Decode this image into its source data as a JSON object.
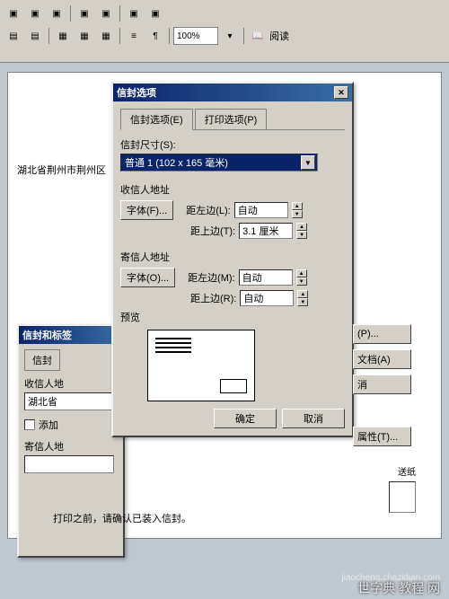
{
  "toolbar": {
    "zoom": "100%",
    "read_label": "阅读"
  },
  "doc": {
    "address": "湖北省荆州市荆州区"
  },
  "back_dialog": {
    "title": "信封和标签",
    "tab_envelope": "信封",
    "recipient_label": "收信人地",
    "input_value": "湖北省",
    "add_checkbox": "添加",
    "sender_label": "寄信人地"
  },
  "dialog": {
    "title": "信封选项",
    "tab_envelope": "信封选项(E)",
    "tab_print": "打印选项(P)",
    "size_label": "信封尺寸(S):",
    "size_value": "普通 1      (102 x 165 毫米)",
    "recipient_section": "收信人地址",
    "sender_section": "寄信人地址",
    "font_btn": "字体(F)...",
    "font_btn2": "字体(O)...",
    "margin_left": "距左边(L):",
    "margin_top": "距上边(T):",
    "margin_left2": "距左边(M):",
    "margin_top2": "距上边(R):",
    "auto": "自动",
    "top_value": "3.1 厘米",
    "preview_label": "预览",
    "ok": "确定",
    "cancel": "取消"
  },
  "side": {
    "btn1": "(P)...",
    "btn2": "文档(A)",
    "btn3": "消",
    "btn4": "属性(T)...",
    "feed_label": "送纸"
  },
  "status": "打印之前，请确认已装入信封。",
  "watermark": {
    "line1": "世字典 教程 网",
    "line2": "jiaocheng.chazidian.com"
  }
}
